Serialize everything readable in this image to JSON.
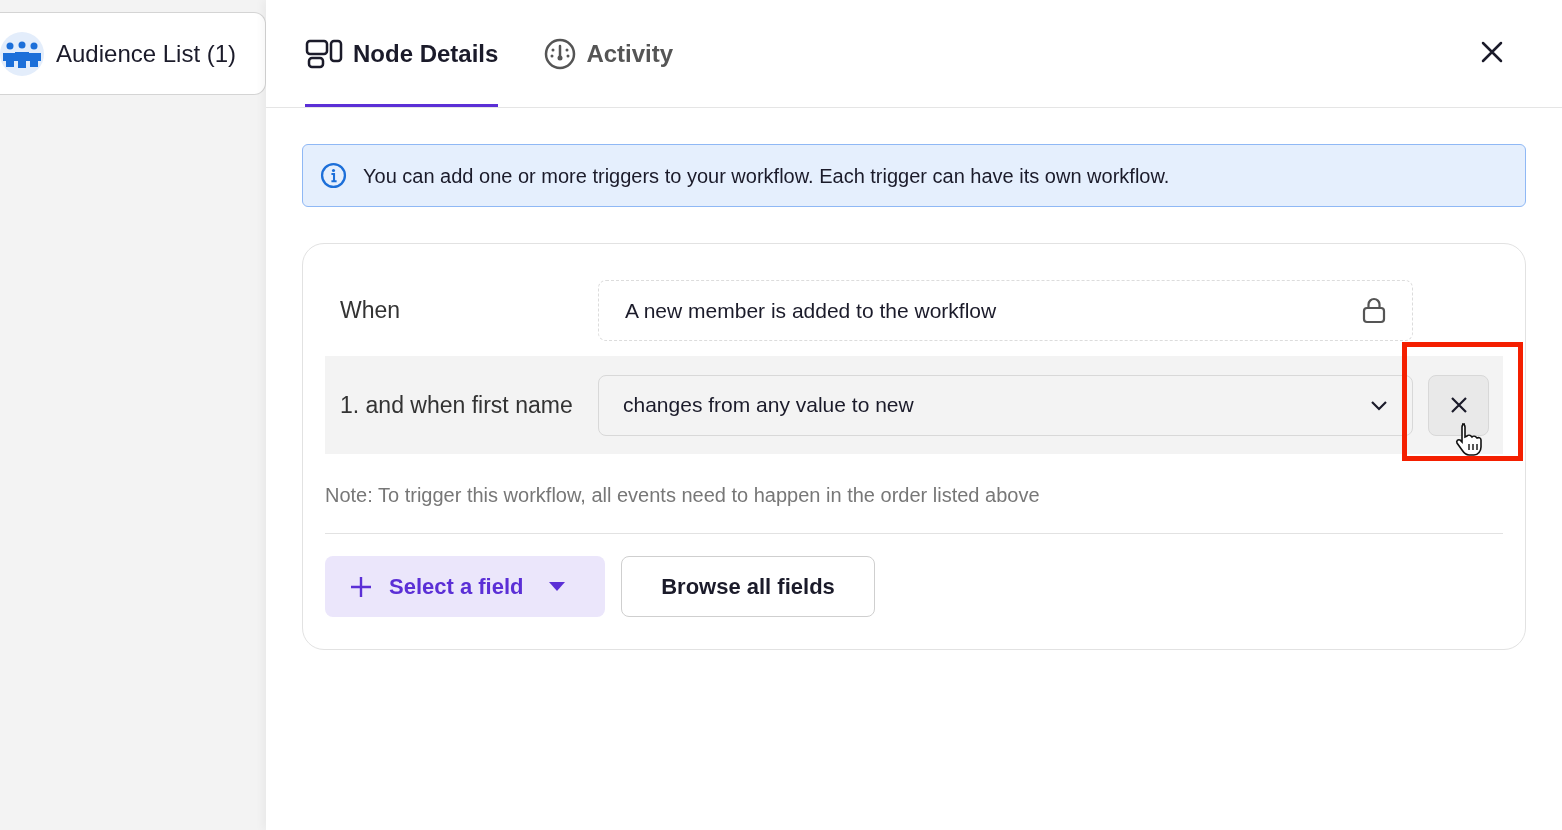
{
  "sidebar": {
    "card": {
      "title": "Audience List (1)"
    }
  },
  "tabs": [
    {
      "label": "Node Details",
      "kind": "details",
      "selected": true
    },
    {
      "label": "Activity",
      "kind": "activity",
      "selected": false
    }
  ],
  "info_banner": {
    "text": "You can add one or more triggers to your workflow. Each trigger can have its own workflow."
  },
  "trigger": {
    "when_label": "When",
    "when_value": "A new member is added to the workflow",
    "locked": true,
    "conditions": [
      {
        "label": "1. and when first name",
        "value": "changes from any value to new",
        "highlighted": true
      }
    ],
    "note": "Note: To trigger this workflow, all events need to happen in the order listed above",
    "buttons": [
      {
        "label": "Select a field",
        "kind": "select"
      },
      {
        "label": "Browse all fields",
        "kind": "browse"
      }
    ]
  }
}
